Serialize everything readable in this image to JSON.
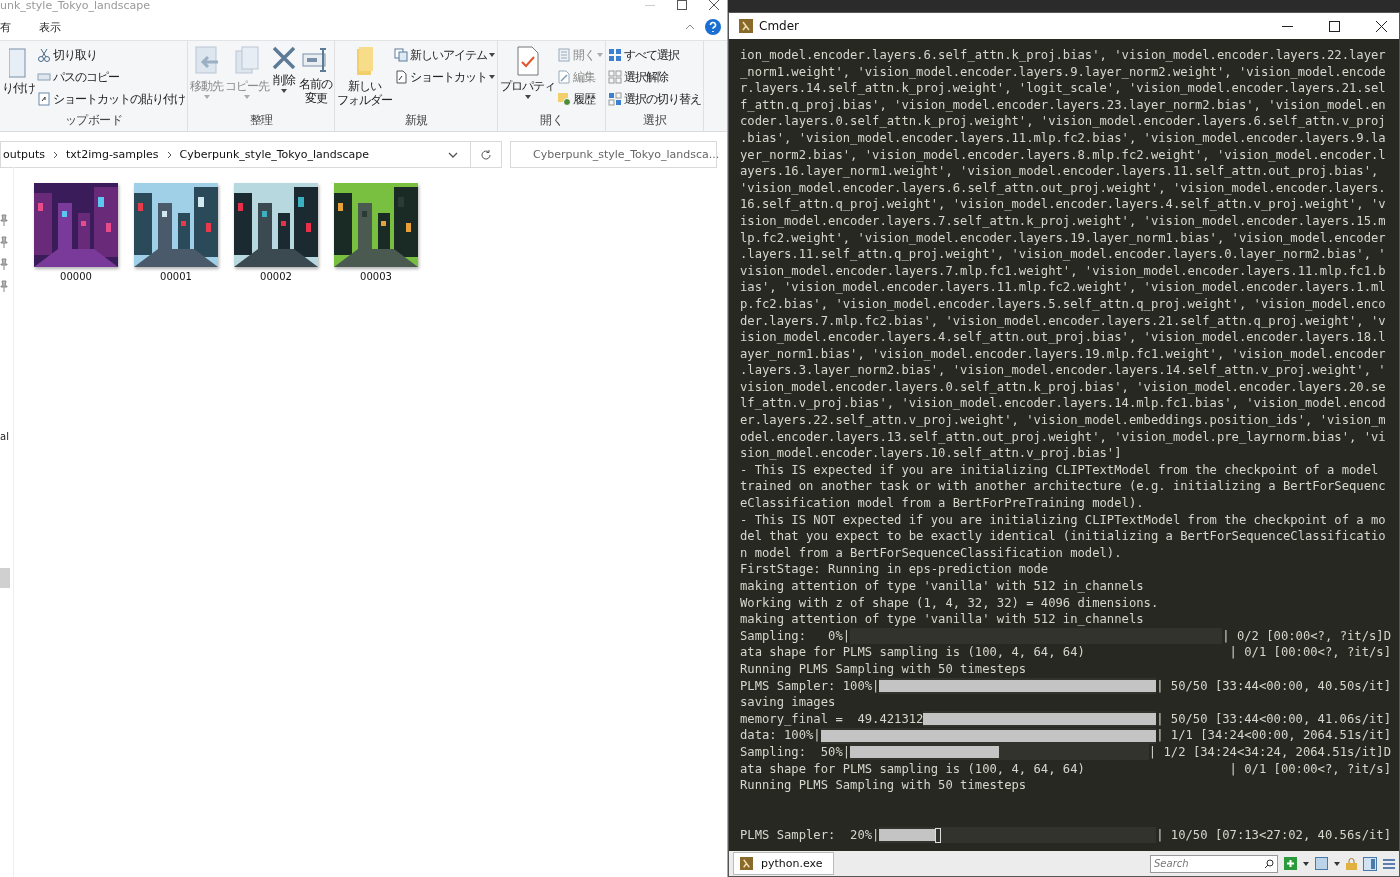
{
  "explorer": {
    "title": "unk_style_Tokyo_landscape",
    "menu_tabs": [
      {
        "label": "有",
        "selected": false
      },
      {
        "label": "表示",
        "selected": false
      }
    ],
    "ribbon_groups": [
      {
        "label": "ップボード",
        "items": [
          {
            "kind": "large",
            "label": "り付け",
            "disabled": false,
            "dropdown": false
          },
          {
            "kind": "small",
            "label": "切り取り",
            "disabled": false,
            "dropdown": false
          },
          {
            "kind": "small",
            "label": "パスのコピー",
            "disabled": false,
            "dropdown": false
          },
          {
            "kind": "small",
            "label": "ショートカットの貼り付け",
            "disabled": false,
            "dropdown": false
          }
        ]
      },
      {
        "label": "整理",
        "items": [
          {
            "kind": "large",
            "label": "移動先",
            "disabled": true,
            "dropdown": true
          },
          {
            "kind": "large",
            "label": "コピー先",
            "disabled": true,
            "dropdown": true
          },
          {
            "kind": "large",
            "label": "削除",
            "disabled": false,
            "dropdown": true
          },
          {
            "kind": "large",
            "label_lines": [
              "名前の",
              "変更"
            ],
            "disabled": false,
            "dropdown": false
          }
        ]
      },
      {
        "label": "新規",
        "items": [
          {
            "kind": "large",
            "label_lines": [
              "新しい",
              "フォルダー"
            ],
            "disabled": false,
            "dropdown": false
          },
          {
            "kind": "small",
            "label": "新しいアイテム",
            "disabled": false,
            "dropdown": true
          },
          {
            "kind": "small",
            "label": "ショートカット",
            "disabled": false,
            "dropdown": true
          }
        ]
      },
      {
        "label": "開く",
        "items": [
          {
            "kind": "large",
            "label": "プロパティ",
            "disabled": false,
            "dropdown": true
          },
          {
            "kind": "small",
            "label": "開く",
            "disabled": true,
            "dropdown": true
          },
          {
            "kind": "small",
            "label": "編集",
            "disabled": true,
            "dropdown": false
          },
          {
            "kind": "small",
            "label": "履歴",
            "disabled": false,
            "dropdown": false
          }
        ]
      },
      {
        "label": "選択",
        "items": [
          {
            "kind": "small",
            "label": "すべて選択",
            "disabled": false,
            "dropdown": false
          },
          {
            "kind": "small",
            "label": "選択解除",
            "disabled": false,
            "dropdown": false
          },
          {
            "kind": "small",
            "label": "選択の切り替え",
            "disabled": false,
            "dropdown": false
          }
        ]
      }
    ],
    "address": {
      "crumbs": [
        "outputs",
        "txt2img-samples",
        "Cyberpunk_style_Tokyo_landscape"
      ]
    },
    "search": {
      "placeholder": "Cyberpunk_style_Tokyo_landsca..."
    },
    "nav_label": "al",
    "files": [
      {
        "name": "00000",
        "kind": "picture"
      },
      {
        "name": "00001",
        "kind": "picture"
      },
      {
        "name": "00002",
        "kind": "picture"
      },
      {
        "name": "00003",
        "kind": "picture"
      }
    ]
  },
  "terminal": {
    "title": "Cmder",
    "lines": [
      {
        "kind": "text",
        "text": "ion_model.encoder.layers.6.self_attn.k_proj.bias', 'vision_model.encoder.layers.22.layer"
      },
      {
        "kind": "text",
        "text": "_norm1.weight', 'vision_model.encoder.layers.9.layer_norm2.weight', 'vision_model.encode"
      },
      {
        "kind": "text",
        "text": "r.layers.14.self_attn.k_proj.weight', 'logit_scale', 'vision_model.encoder.layers.21.sel"
      },
      {
        "kind": "text",
        "text": "f_attn.q_proj.bias', 'vision_model.encoder.layers.23.layer_norm2.bias', 'vision_model.en"
      },
      {
        "kind": "text",
        "text": "coder.layers.0.self_attn.k_proj.weight', 'vision_model.encoder.layers.6.self_attn.v_proj"
      },
      {
        "kind": "text",
        "text": ".bias', 'vision_model.encoder.layers.11.mlp.fc2.bias', 'vision_model.encoder.layers.9.la"
      },
      {
        "kind": "text",
        "text": "yer_norm2.bias', 'vision_model.encoder.layers.8.mlp.fc2.weight', 'vision_model.encoder.l"
      },
      {
        "kind": "text",
        "text": "ayers.16.layer_norm1.weight', 'vision_model.encoder.layers.11.self_attn.out_proj.bias',"
      },
      {
        "kind": "text",
        "text": "'vision_model.encoder.layers.6.self_attn.out_proj.weight', 'vision_model.encoder.layers."
      },
      {
        "kind": "text",
        "text": "16.self_attn.q_proj.weight', 'vision_model.encoder.layers.4.self_attn.v_proj.weight', 'v"
      },
      {
        "kind": "text",
        "text": "ision_model.encoder.layers.7.self_attn.k_proj.weight', 'vision_model.encoder.layers.15.m"
      },
      {
        "kind": "text",
        "text": "lp.fc2.weight', 'vision_model.encoder.layers.19.layer_norm1.bias', 'vision_model.encoder"
      },
      {
        "kind": "text",
        "text": ".layers.11.self_attn.q_proj.weight', 'vision_model.encoder.layers.0.layer_norm2.bias', '"
      },
      {
        "kind": "text",
        "text": "vision_model.encoder.layers.7.mlp.fc1.weight', 'vision_model.encoder.layers.11.mlp.fc1.b"
      },
      {
        "kind": "text",
        "text": "ias', 'vision_model.encoder.layers.11.mlp.fc2.weight', 'vision_model.encoder.layers.1.ml"
      },
      {
        "kind": "text",
        "text": "p.fc2.bias', 'vision_model.encoder.layers.5.self_attn.q_proj.weight', 'vision_model.enco"
      },
      {
        "kind": "text",
        "text": "der.layers.7.mlp.fc2.bias', 'vision_model.encoder.layers.21.self_attn.q_proj.weight', 'v"
      },
      {
        "kind": "text",
        "text": "ision_model.encoder.layers.4.self_attn.out_proj.bias', 'vision_model.encoder.layers.18.l"
      },
      {
        "kind": "text",
        "text": "ayer_norm1.bias', 'vision_model.encoder.layers.19.mlp.fc1.weight', 'vision_model.encoder"
      },
      {
        "kind": "text",
        "text": ".layers.3.layer_norm2.bias', 'vision_model.encoder.layers.14.self_attn.v_proj.weight', '"
      },
      {
        "kind": "text",
        "text": "vision_model.encoder.layers.0.self_attn.k_proj.bias', 'vision_model.encoder.layers.20.se"
      },
      {
        "kind": "text",
        "text": "lf_attn.v_proj.bias', 'vision_model.encoder.layers.14.mlp.fc1.bias', 'vision_model.encod"
      },
      {
        "kind": "text",
        "text": "er.layers.22.self_attn.v_proj.weight', 'vision_model.embeddings.position_ids', 'vision_m"
      },
      {
        "kind": "text",
        "text": "odel.encoder.layers.13.self_attn.out_proj.weight', 'vision_model.pre_layrnorm.bias', 'vi"
      },
      {
        "kind": "text",
        "text": "sion_model.encoder.layers.10.self_attn.v_proj.bias']"
      },
      {
        "kind": "text",
        "text": "- This IS expected if you are initializing CLIPTextModel from the checkpoint of a model"
      },
      {
        "kind": "text",
        "text": "trained on another task or with another architecture (e.g. initializing a BertForSequenc"
      },
      {
        "kind": "text",
        "text": "eClassification model from a BertForPreTraining model)."
      },
      {
        "kind": "text",
        "text": "- This IS NOT expected if you are initializing CLIPTextModel from the checkpoint of a mo"
      },
      {
        "kind": "text",
        "text": "del that you expect to be exactly identical (initializing a BertForSequenceClassificatio"
      },
      {
        "kind": "text",
        "text": "n model from a BertForSequenceClassification model)."
      },
      {
        "kind": "text",
        "text": "FirstStage: Running in eps-prediction mode"
      },
      {
        "kind": "text",
        "text": "making attention of type 'vanilla' with 512 in_channels"
      },
      {
        "kind": "text",
        "text": "Working with z of shape (1, 4, 32, 32) = 4096 dimensions."
      },
      {
        "kind": "text",
        "text": "making attention of type 'vanilla' with 512 in_channels"
      },
      {
        "kind": "progress",
        "prefix": "Sampling:   0%|",
        "suffix": "| 0/2 [00:00<?, ?it/s]D",
        "cursor": false
      },
      {
        "kind": "columns",
        "left": "ata shape for PLMS sampling is (100, 4, 64, 64)",
        "right": "| 0/1 [00:00<?, ?it/s]"
      },
      {
        "kind": "text",
        "text": "Running PLMS Sampling with 50 timesteps"
      },
      {
        "kind": "progress",
        "prefix": "PLMS Sampler: 100%|",
        "level": 1,
        "suffix": "| 50/50 [33:44<00:00, 40.50s/it]",
        "cursor": false
      },
      {
        "kind": "text",
        "text": "saving images"
      },
      {
        "kind": "progress",
        "prefix": "memory_final =  49.421312",
        "level": 1,
        "suffix": "| 50/50 [33:44<00:00, 41.06s/it]",
        "cursor": false
      },
      {
        "kind": "progress",
        "prefix": "data: 100%|",
        "level": 1,
        "suffix": "| 1/1 [34:24<00:00, 2064.51s/it]",
        "cursor": false
      },
      {
        "kind": "progress",
        "prefix": "Sampling:  50%|",
        "level": 0.5,
        "suffix": "| 1/2 [34:24<34:24, 2064.51s/it]D",
        "cursor": false
      },
      {
        "kind": "columns",
        "left": "ata shape for PLMS sampling is (100, 4, 64, 64)",
        "right": "| 0/1 [00:00<?, ?it/s]"
      },
      {
        "kind": "text",
        "text": "Running PLMS Sampling with 50 timesteps"
      },
      {
        "kind": "blank"
      },
      {
        "kind": "blank"
      },
      {
        "kind": "progress",
        "prefix": "PLMS Sampler:  20%|",
        "level": 0.2,
        "suffix": "| 10/50 [07:13<27:02, 40.56s/it]",
        "cursor": true
      }
    ],
    "tabs": [
      {
        "label": "python.exe",
        "selected": true
      }
    ],
    "search": {
      "placeholder": "Search"
    }
  }
}
